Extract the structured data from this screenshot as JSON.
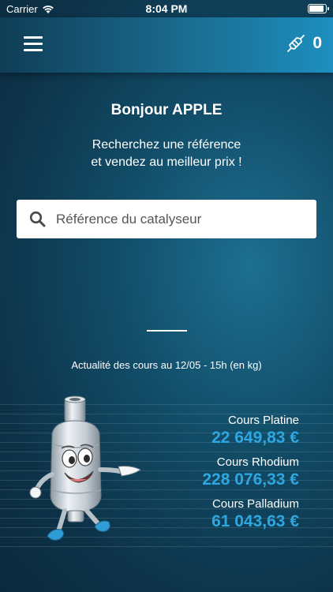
{
  "status": {
    "carrier": "Carrier",
    "time": "8:04 PM",
    "battery_level": 0.95
  },
  "nav": {
    "cart_count": "0"
  },
  "hero": {
    "greeting": "Bonjour APPLE",
    "subtitle_line1": "Recherchez une référence",
    "subtitle_line2": "et vendez au meilleur prix !"
  },
  "search": {
    "placeholder": "Référence du catalyseur",
    "value": ""
  },
  "rates": {
    "title": "Actualité des cours au 12/05 - 15h (en kg)",
    "items": [
      {
        "label": "Cours Platine",
        "value": "22 649,83 €"
      },
      {
        "label": "Cours Rhodium",
        "value": "228 076,33 €"
      },
      {
        "label": "Cours Palladium",
        "value": "61 043,63 €"
      }
    ]
  },
  "colors": {
    "accent": "#2ea7e0",
    "nav_start": "#0f3d56",
    "nav_end": "#1d8fc0"
  }
}
